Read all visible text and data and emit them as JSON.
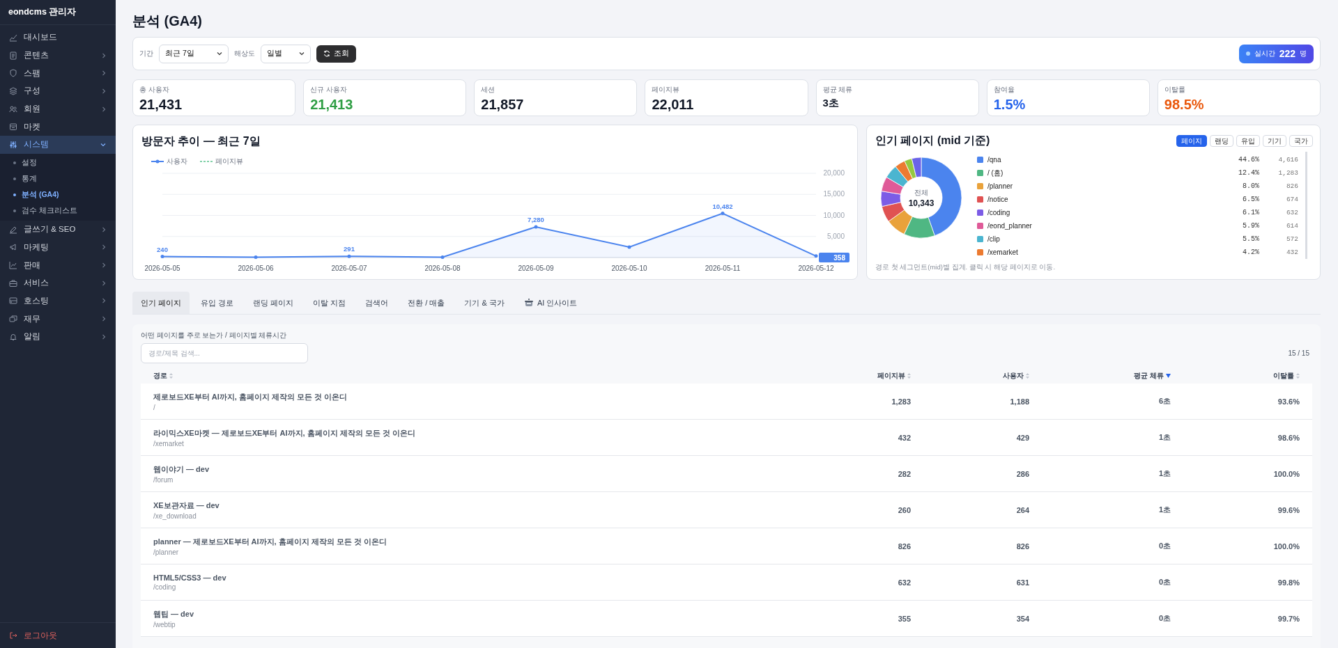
{
  "sidebar": {
    "brand": "eondcms 관리자",
    "items": [
      {
        "label": "대시보드",
        "kind": "link",
        "selected": false
      },
      {
        "label": "콘텐츠",
        "kind": "group",
        "expanded": false,
        "selected": false
      },
      {
        "label": "스팸",
        "kind": "group",
        "expanded": false,
        "selected": false
      },
      {
        "label": "구성",
        "kind": "group",
        "expanded": false,
        "selected": false
      },
      {
        "label": "회원",
        "kind": "group",
        "expanded": false,
        "selected": false
      },
      {
        "label": "마켓",
        "kind": "link",
        "selected": false
      },
      {
        "label": "시스템",
        "kind": "group",
        "expanded": true,
        "selected": true,
        "children": [
          {
            "label": "설정",
            "selected": false
          },
          {
            "label": "통계",
            "selected": false
          },
          {
            "label": "분석 (GA4)",
            "selected": true
          },
          {
            "label": "검수 체크리스트",
            "selected": false
          }
        ]
      },
      {
        "label": "글쓰기 & SEO",
        "kind": "group",
        "expanded": false,
        "selected": false
      },
      {
        "label": "마케팅",
        "kind": "group",
        "expanded": false,
        "selected": false
      },
      {
        "label": "판매",
        "kind": "group",
        "expanded": false,
        "selected": false
      },
      {
        "label": "서비스",
        "kind": "group",
        "expanded": false,
        "selected": false
      },
      {
        "label": "호스팅",
        "kind": "group",
        "expanded": false,
        "selected": false
      },
      {
        "label": "재무",
        "kind": "group",
        "expanded": false,
        "selected": false
      },
      {
        "label": "알림",
        "kind": "group",
        "expanded": false,
        "selected": false
      }
    ],
    "logout": "로그아웃"
  },
  "page_title": "분석 (GA4)",
  "filters": {
    "period_label": "기간",
    "period": "최근 7일",
    "resolution_label": "해상도",
    "resolution": "일별",
    "query_button": "조회",
    "realtime": {
      "label": "실시간",
      "count": "222",
      "unit": "명"
    }
  },
  "kpis": [
    {
      "label": "총 사용자",
      "value": "21,431",
      "color": "#111827",
      "compact": false
    },
    {
      "label": "신규 사용자",
      "value": "21,413",
      "color": "#2f9e44",
      "compact": false
    },
    {
      "label": "세션",
      "value": "21,857",
      "color": "#111827",
      "compact": false
    },
    {
      "label": "페이지뷰",
      "value": "22,011",
      "color": "#111827",
      "compact": false
    },
    {
      "label": "평균 체류",
      "value": "3초",
      "color": "#111827",
      "compact": true
    },
    {
      "label": "참여율",
      "value": "1.5%",
      "color": "#2563eb",
      "compact": false
    },
    {
      "label": "이탈률",
      "value": "98.5%",
      "color": "#ea580c",
      "compact": false
    }
  ],
  "visitor_chart": {
    "title": "방문자 추이 — 최근 7일",
    "chart_data": {
      "type": "line",
      "grid": true,
      "categories": [
        "2026-05-05",
        "2026-05-06",
        "2026-05-07",
        "2026-05-08",
        "2026-05-09",
        "2026-05-10",
        "2026-05-11",
        "2026-05-12"
      ],
      "series": [
        {
          "name": "사용자",
          "color": "#4b84ee",
          "values": [
            240,
            100,
            291,
            100,
            7280,
            2500,
            10482,
            358
          ]
        },
        {
          "name": "페이지뷰",
          "color": "#5cc48f",
          "values": [
            null,
            null,
            null,
            null,
            null,
            null,
            null,
            null
          ]
        }
      ],
      "ylim": [
        0,
        20000
      ],
      "yticks": [
        {
          "value": 5000,
          "label": "5,000"
        },
        {
          "value": 10000,
          "label": "10,000"
        },
        {
          "value": 15000,
          "label": "15,000"
        },
        {
          "value": 20000,
          "label": "20,000"
        }
      ],
      "value_labels": [
        "240",
        null,
        "291",
        null,
        "7,280",
        null,
        "10,482",
        "358"
      ]
    }
  },
  "popular_pages": {
    "title": "인기 페이지 (mid 기준)",
    "tabs": [
      {
        "label": "페이지",
        "selected": true
      },
      {
        "label": "랜딩",
        "selected": false
      },
      {
        "label": "유입",
        "selected": false
      },
      {
        "label": "기기",
        "selected": false
      },
      {
        "label": "국가",
        "selected": false
      }
    ],
    "center_label": "전체",
    "center_value": "10,343",
    "chart_data": {
      "type": "donut",
      "categories": [
        "/qna",
        "/ (홈)",
        "/planner",
        "/notice",
        "/coding",
        "/eond_planner",
        "/clip",
        "/xemarket",
        null,
        null
      ],
      "values": [
        44.6,
        12.4,
        8.0,
        6.5,
        6.1,
        5.9,
        5.5,
        4.2,
        3.0,
        3.8
      ],
      "colors": [
        "#4b84ee",
        "#4fb783",
        "#e9a23b",
        "#e05252",
        "#7c5ce6",
        "#df5a98",
        "#4bb5d0",
        "#ec7a30",
        "#94c840",
        "#6a63e8"
      ]
    },
    "legend": [
      {
        "share": "44.6%",
        "count": "4,616"
      },
      {
        "share": "12.4%",
        "count": "1,283"
      },
      {
        "share": "8.0%",
        "count": "826"
      },
      {
        "share": "6.5%",
        "count": "674"
      },
      {
        "share": "6.1%",
        "count": "632"
      },
      {
        "share": "5.9%",
        "count": "614"
      },
      {
        "share": "5.5%",
        "count": "572"
      },
      {
        "share": "4.2%",
        "count": "432"
      }
    ],
    "note": "경로 첫 세그먼트(mid)별 집계. 클릭 시 해당 페이지로 이동."
  },
  "tabs": [
    {
      "label": "인기 페이지",
      "selected": true,
      "kind": "plain"
    },
    {
      "label": "유입 경로",
      "selected": false,
      "kind": "plain"
    },
    {
      "label": "랜딩 페이지",
      "selected": false,
      "kind": "plain"
    },
    {
      "label": "이탈 지점",
      "selected": false,
      "kind": "plain"
    },
    {
      "label": "검색어",
      "selected": false,
      "kind": "plain"
    },
    {
      "label": "전환 / 매출",
      "selected": false,
      "kind": "plain"
    },
    {
      "label": "기기 & 국가",
      "selected": false,
      "kind": "plain"
    },
    {
      "label": "AI 인사이트",
      "selected": false,
      "kind": "ai"
    }
  ],
  "table": {
    "caption": "어떤 페이지를 주로 보는가 / 페이지별 체류시간",
    "search": {
      "placeholder": "경로/제목 검색..."
    },
    "count": "15 / 15",
    "columns": [
      {
        "label": "경로",
        "sorted": false
      },
      {
        "label": "페이지뷰",
        "sorted": false
      },
      {
        "label": "사용자",
        "sorted": false
      },
      {
        "label": "평균 체류",
        "sorted": true
      },
      {
        "label": "이탈률",
        "sorted": false
      }
    ],
    "rows": [
      {
        "title": "제로보드XE부터 AI까지, 홈페이지 제작의 모든 것 이온디",
        "path": "/",
        "cells": [
          "1,283",
          "1,188",
          "6초",
          "93.6%"
        ]
      },
      {
        "title": "라이믹스XE마켓 — 제로보드XE부터 AI까지, 홈페이지 제작의 모든 것 이온디",
        "path": "/xemarket",
        "cells": [
          "432",
          "429",
          "1초",
          "98.6%"
        ]
      },
      {
        "title": "웹이야기 — dev",
        "path": "/forum",
        "cells": [
          "282",
          "286",
          "1초",
          "100.0%"
        ]
      },
      {
        "title": "XE보관자료 — dev",
        "path": "/xe_download",
        "cells": [
          "260",
          "264",
          "1초",
          "99.6%"
        ]
      },
      {
        "title": "planner — 제로보드XE부터 AI까지, 홈페이지 제작의 모든 것 이온디",
        "path": "/planner",
        "cells": [
          "826",
          "826",
          "0초",
          "100.0%"
        ]
      },
      {
        "title": "HTML5/CSS3 — dev",
        "path": "/coding",
        "cells": [
          "632",
          "631",
          "0초",
          "99.8%"
        ]
      },
      {
        "title": "웹팁 — dev",
        "path": "/webtip",
        "cells": [
          "355",
          "354",
          "0초",
          "99.7%"
        ]
      }
    ]
  }
}
